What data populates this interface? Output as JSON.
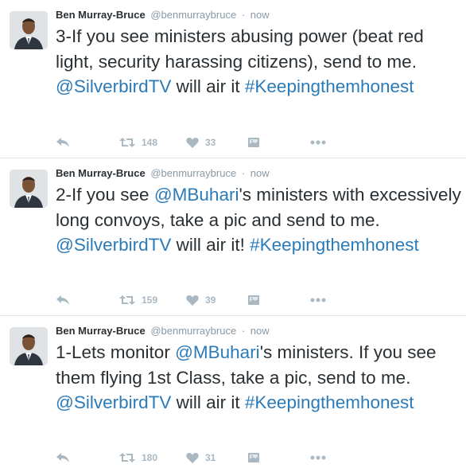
{
  "colors": {
    "link": "#2b7bb9",
    "text": "#292f33",
    "muted": "#8899a6",
    "icon": "#aab8c2",
    "divider": "#e1e8ed"
  },
  "tweets": [
    {
      "name": "Ben Murray-Bruce",
      "handle": "@benmurraybruce",
      "separator": "·",
      "time": "now",
      "text": {
        "p1": "3-If you see ministers abusing power (beat red light, security harassing citizens), send to me. ",
        "mention": "@SilverbirdTV",
        "p2": " will air it ",
        "hashtag": "#Keepingthemhonest"
      },
      "retweets": "148",
      "likes": "33"
    },
    {
      "name": "Ben Murray-Bruce",
      "handle": "@benmurraybruce",
      "separator": "·",
      "time": "now",
      "text": {
        "p0": "2-If you see ",
        "mention1": "@MBuhari",
        "p1": "'s ministers with excessively long convoys, take a pic and send to me. ",
        "mention2": "@SilverbirdTV",
        "p2": " will air it! ",
        "hashtag": "#Keepingthemhonest"
      },
      "retweets": "159",
      "likes": "39"
    },
    {
      "name": "Ben Murray-Bruce",
      "handle": "@benmurraybruce",
      "separator": "·",
      "time": "now",
      "text": {
        "p0": "1-Lets monitor ",
        "mention1": "@MBuhari",
        "p1": "'s ministers. If you see them flying 1st Class, take a pic, send to me. ",
        "mention2": "@SilverbirdTV",
        "p2": " will air it ",
        "hashtag": "#Keepingthemhonest"
      },
      "retweets": "180",
      "likes": "31"
    }
  ],
  "icons": {
    "reply": "reply-icon",
    "retweet": "retweet-icon",
    "like": "heart-icon",
    "media": "media-icon",
    "more": "more-icon"
  }
}
